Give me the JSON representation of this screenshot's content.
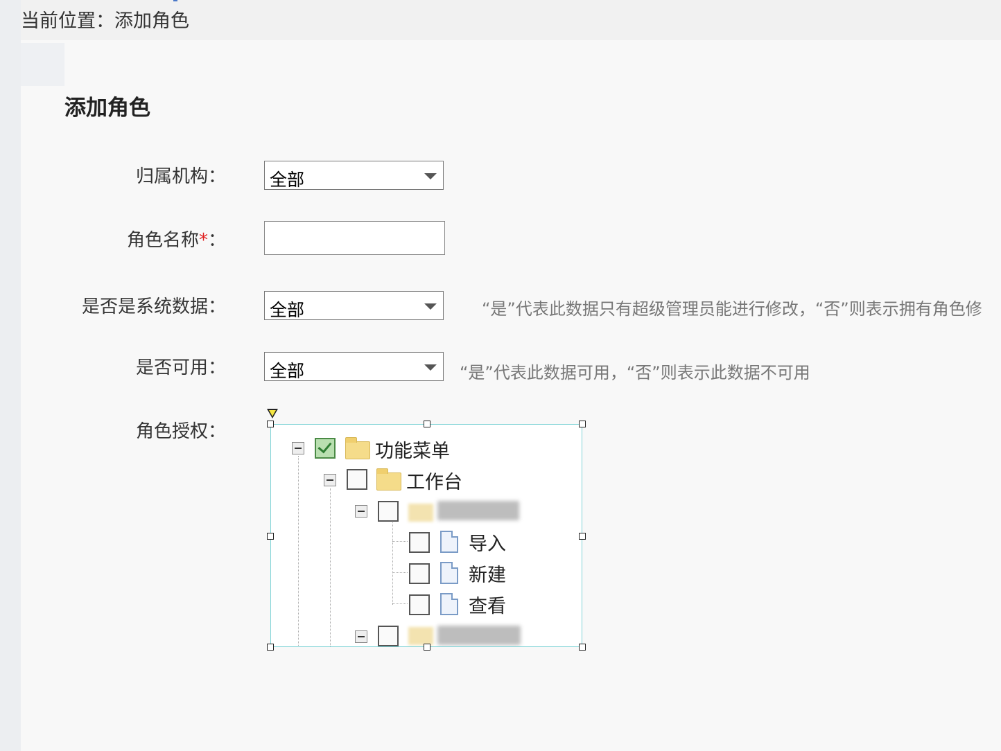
{
  "breadcrumb": "当前位置：添加角色",
  "page_title": "添加角色",
  "form": {
    "org": {
      "label": "归属机构：",
      "value": "全部"
    },
    "role_name": {
      "label": "角色名称",
      "required_mark": "*",
      "colon": "：",
      "value": ""
    },
    "system_data": {
      "label": "是否是系统数据：",
      "value": "全部",
      "hint": "“是”代表此数据只有超级管理员能进行修改，“否”则表示拥有角色修"
    },
    "enabled": {
      "label": "是否可用：",
      "value": "全部",
      "hint": "“是”代表此数据可用，“否”则表示此数据不可用"
    },
    "permissions": {
      "label": "角色授权：",
      "tree": {
        "root": "功能菜单",
        "workbench": "工作台",
        "leaf_import": "导入",
        "leaf_new": "新建",
        "leaf_view": "查看"
      }
    }
  },
  "colors": {
    "required": "#e02020",
    "frame": "#7fd3d6",
    "hint": "#777777"
  }
}
